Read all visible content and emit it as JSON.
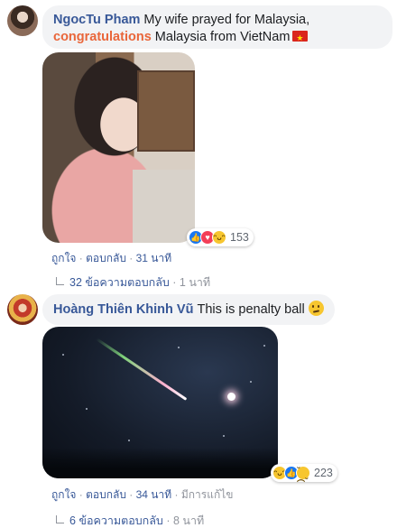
{
  "comments": [
    {
      "author": "NgocTu Pham",
      "text_part1": "My wife prayed for Malaysia,",
      "highlight": "congratulations",
      "text_part2": "Malaysia from VietNam",
      "flag_icon": "vietnam-flag-icon",
      "reactions": {
        "icons": [
          "like-icon",
          "love-icon",
          "haha-icon"
        ],
        "count": "153"
      },
      "actions": {
        "like": "ถูกใจ",
        "reply": "ตอบกลับ",
        "time": "31 นาที"
      },
      "replies": {
        "label": "32 ข้อความตอบกลับ",
        "time": "1 นาที"
      }
    },
    {
      "author": "Hoàng Thiên Khinh Vũ",
      "text": "This is penalty ball",
      "emoji_icon": "confused-face-icon",
      "reactions": {
        "icons": [
          "haha-icon",
          "like-icon",
          "sad-icon"
        ],
        "count": "223"
      },
      "actions": {
        "like": "ถูกใจ",
        "reply": "ตอบกลับ",
        "time": "34 นาที",
        "edited": "มีการแก้ไข"
      },
      "replies": {
        "label": "6 ข้อความตอบกลับ",
        "time": "8 นาที"
      }
    }
  ],
  "colors": {
    "link": "#385898",
    "highlight": "#e9663a",
    "meta": "#90949c",
    "bubble": "#f2f3f5"
  }
}
